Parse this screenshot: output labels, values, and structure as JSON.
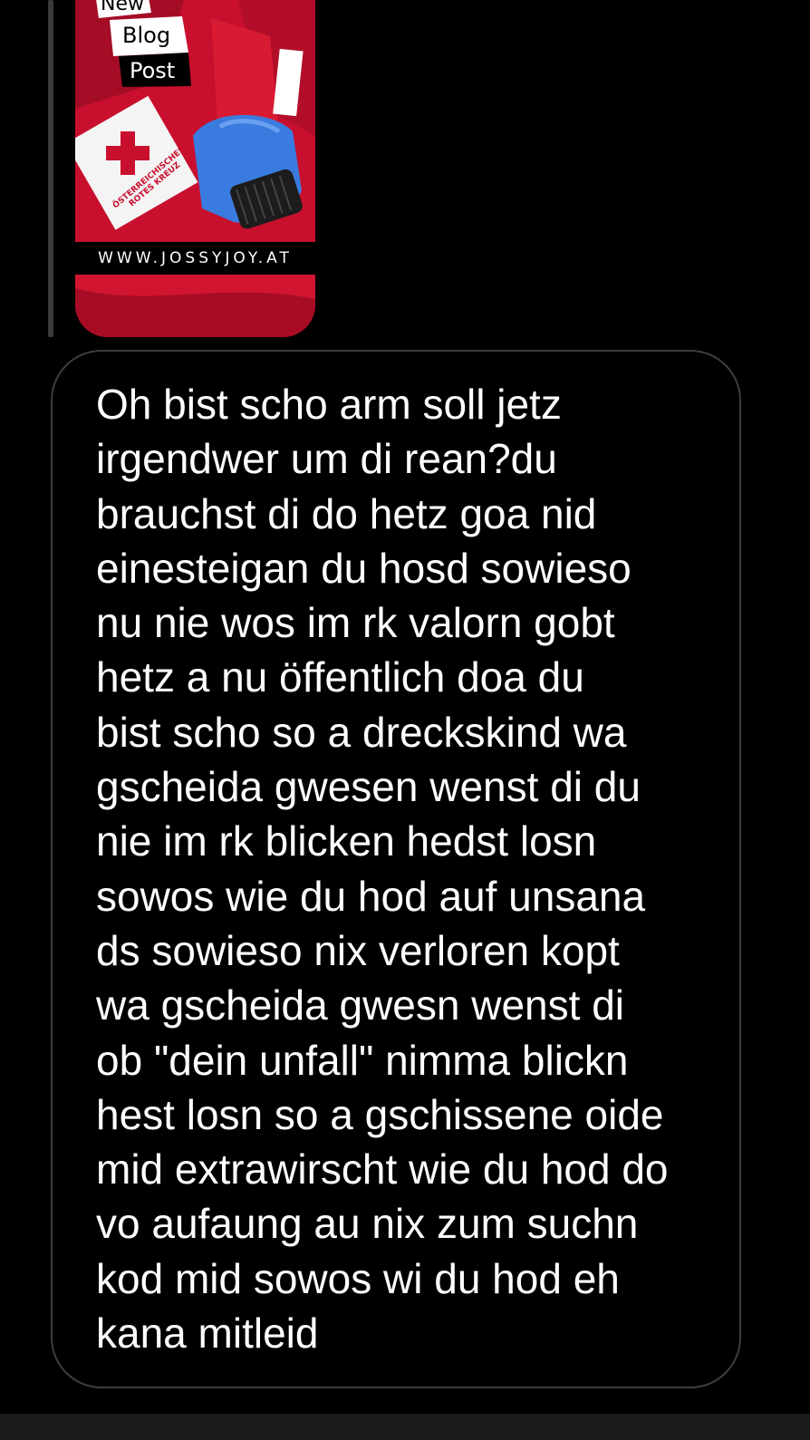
{
  "shared_image": {
    "sticker_line1": "New",
    "sticker_line2": "Blog",
    "sticker_line3": "Post",
    "badge_text": "ÖSTERREICHISCHES\nROTES KREUZ",
    "site_url": "WWW.JOSSYJOY.AT",
    "colors": {
      "red": "#c8102e",
      "glove_blue": "#3a7be0"
    }
  },
  "message": {
    "text": "Oh bist scho arm soll jetz\nirgendwer um di rean?du\nbrauchst di do hetz goa nid\neinesteigan du hosd sowieso\nnu nie wos im rk valorn gobt\nhetz a nu öffentlich doa du\nbist scho so a dreckskind wa\ngscheida gwesen wenst di du\nnie im rk blicken hedst losn\nsowos wie du hod auf unsana\nds sowieso nix verloren kopt\nwa gscheida gwesn wenst di\nob \"dein unfall\" nimma blickn\nhest losn so a gschissene oide\nmid extrawirscht wie du hod do\nvo aufaung au nix zum suchn\nkod mid sowos wi du hod eh\nkana mitleid"
  },
  "theme": {
    "background": "#000000",
    "bubble_border": "#3d3d3d",
    "text_color": "#ffffff"
  }
}
